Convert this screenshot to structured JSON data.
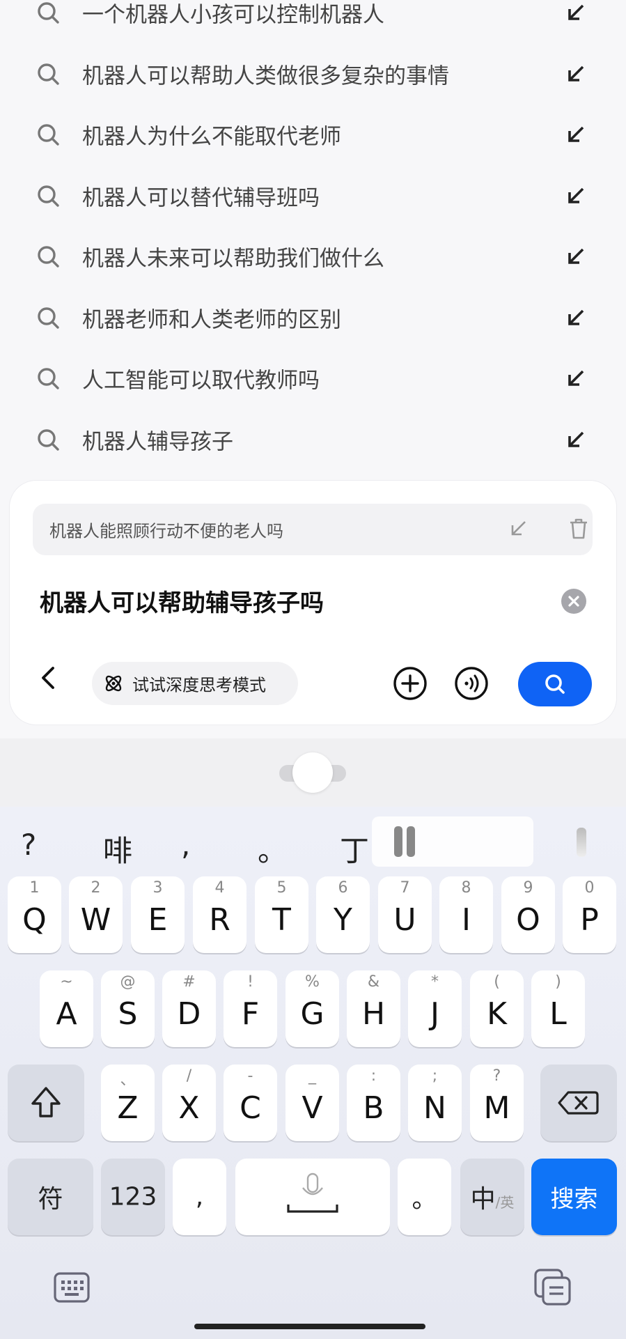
{
  "suggestions": [
    {
      "text": "一个机器人小孩可以控制机器人"
    },
    {
      "text": "机器人可以帮助人类做很多复杂的事情"
    },
    {
      "text": "机器人为什么不能取代老师"
    },
    {
      "text": "机器人可以替代辅导班吗"
    },
    {
      "text": "机器人未来可以帮助我们做什么"
    },
    {
      "text": "机器老师和人类老师的区别"
    },
    {
      "text": "人工智能可以取代教师吗"
    },
    {
      "text": "机器人辅导孩子"
    }
  ],
  "search_card": {
    "history_text": "机器人能照顾行动不便的老人吗",
    "query": "机器人可以帮助辅导孩子吗",
    "deep_think_label": "试试深度思考模式"
  },
  "keyboard": {
    "candidates": [
      "?",
      "啡",
      ",",
      "。",
      "丁"
    ],
    "row1": [
      {
        "sub": "1",
        "main": "Q"
      },
      {
        "sub": "2",
        "main": "W"
      },
      {
        "sub": "3",
        "main": "E"
      },
      {
        "sub": "4",
        "main": "R"
      },
      {
        "sub": "5",
        "main": "T"
      },
      {
        "sub": "6",
        "main": "Y"
      },
      {
        "sub": "7",
        "main": "U"
      },
      {
        "sub": "8",
        "main": "I"
      },
      {
        "sub": "9",
        "main": "O"
      },
      {
        "sub": "0",
        "main": "P"
      }
    ],
    "row2": [
      {
        "sub": "~",
        "main": "A"
      },
      {
        "sub": "@",
        "main": "S"
      },
      {
        "sub": "#",
        "main": "D"
      },
      {
        "sub": "!",
        "main": "F"
      },
      {
        "sub": "%",
        "main": "G"
      },
      {
        "sub": "&",
        "main": "H"
      },
      {
        "sub": "*",
        "main": "J"
      },
      {
        "sub": "(",
        "main": "K"
      },
      {
        "sub": ")",
        "main": "L"
      }
    ],
    "row3": [
      {
        "sub": "、",
        "main": "Z"
      },
      {
        "sub": "/",
        "main": "X"
      },
      {
        "sub": "-",
        "main": "C"
      },
      {
        "sub": "_",
        "main": "V"
      },
      {
        "sub": ":",
        "main": "B"
      },
      {
        "sub": ";",
        "main": "N"
      },
      {
        "sub": "?",
        "main": "M"
      }
    ],
    "symbol_key": "符",
    "num_key": "123",
    "comma_key": ",",
    "period_key": "。",
    "lang_main": "中",
    "lang_sub": "/英",
    "search_key": "搜索"
  }
}
